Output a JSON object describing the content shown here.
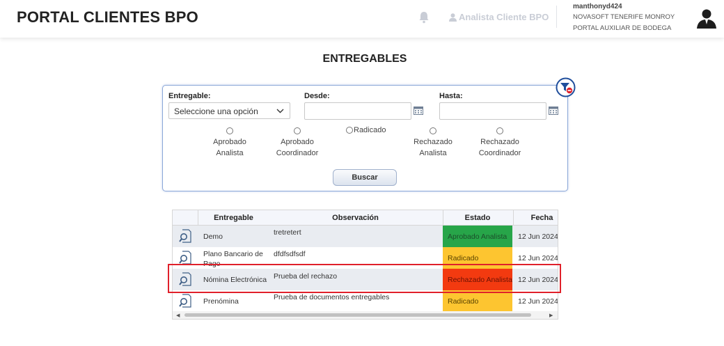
{
  "header": {
    "brand": "PORTAL CLIENTES BPO",
    "role_label": "Analista Cliente BPO",
    "username": "manthonyd424",
    "company": "NOVASOFT TENERIFE MONROY PORTAL AUXILIAR DE BODEGA"
  },
  "page": {
    "title": "ENTREGABLES"
  },
  "filters": {
    "entregable_label": "Entregable:",
    "entregable_value": "Seleccione una opción",
    "desde_label": "Desde:",
    "hasta_label": "Hasta:",
    "desde_value": "",
    "hasta_value": "",
    "radios": [
      {
        "line1": "Aprobado",
        "line2": "Analista"
      },
      {
        "line1": "Aprobado",
        "line2": "Coordinador"
      },
      {
        "line1": "Radicado",
        "line2": ""
      },
      {
        "line1": "Rechazado",
        "line2": "Analista"
      },
      {
        "line1": "Rechazado",
        "line2": "Coordinador"
      }
    ],
    "search_button": "Buscar"
  },
  "table": {
    "columns": [
      "Entregable",
      "Observación",
      "Estado",
      "Fecha"
    ],
    "rows": [
      {
        "entregable": "Demo",
        "observacion": "tretretert",
        "estado": "Aprobado Analista",
        "estado_color": "#27a549",
        "fecha": "12 Jun 2024"
      },
      {
        "entregable": "Plano Bancario de Pago",
        "observacion": "dfdfsdfsdf",
        "estado": "Radicado",
        "estado_color": "#fdc530",
        "fecha": "12 Jun 2024"
      },
      {
        "entregable": "Nómina Electrónica",
        "observacion": "Prueba del rechazo",
        "estado": "Rechazado Analista",
        "estado_color": "#f33a10",
        "fecha": "12 Jun 2024"
      },
      {
        "entregable": "Prenómina",
        "observacion": "Prueba de documentos entregables",
        "estado": "Radicado",
        "estado_color": "#fdc530",
        "fecha": "12 Jun 2024"
      }
    ]
  },
  "colors": {
    "accent": "#1f4e9c",
    "highlight": "#e0202a"
  }
}
